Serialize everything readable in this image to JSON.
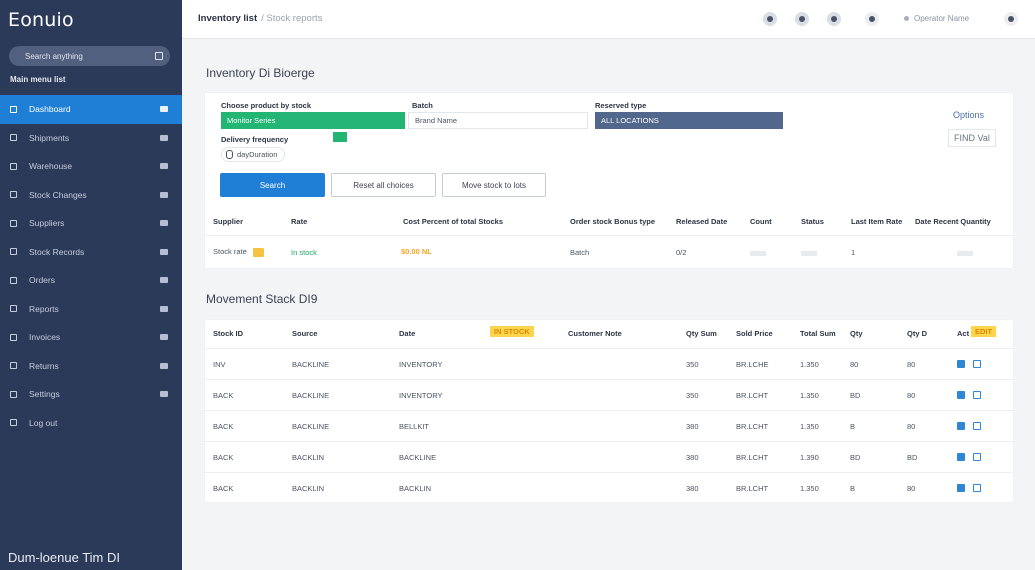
{
  "sidebar": {
    "brand": "Eonuio",
    "search_placeholder": "Search anything",
    "section_label": "Main menu list",
    "items": [
      {
        "label": "Dashboard",
        "active": true
      },
      {
        "label": "Shipments"
      },
      {
        "label": "Warehouse"
      },
      {
        "label": "Stock Changes"
      },
      {
        "label": "Suppliers"
      },
      {
        "label": "Stock Records"
      },
      {
        "label": "Orders"
      },
      {
        "label": "Reports"
      },
      {
        "label": "Invoices"
      },
      {
        "label": "Returns"
      },
      {
        "label": "Settings"
      },
      {
        "label": "Log out"
      }
    ],
    "footer": "Dum-loenue Tim DI"
  },
  "topbar": {
    "breadcrumb_main": "Inventory list",
    "breadcrumb_sub": "/ Stock reports",
    "user_label": "Operator Name"
  },
  "section1": {
    "title": "Inventory Di Bioerge",
    "fields": {
      "field1_label": "Choose product by stock",
      "field1_value": "Monitor Series",
      "field2_label": "Batch",
      "field2_value": "Brand Name",
      "field3_label": "Reserved type",
      "field3_value": "ALL LOCATIONS",
      "field4_label": "Delivery frequency",
      "radio_label": "dayDuration"
    },
    "right_link": "Options",
    "right_chip": "FIND Val",
    "buttons": {
      "primary": "Search",
      "secondary1": "Reset all choices",
      "secondary2": "Move stock to lots"
    },
    "table": {
      "headers": [
        "Supplier",
        "Rate",
        "Cost Percent of total Stocks",
        "Order stock Bonus type",
        "Released Date",
        "Count",
        "Status",
        "Last Item Rate",
        "Date Recent Quantity"
      ],
      "row": {
        "c1": "Stock rate",
        "c2": "In stock",
        "c3": "$0.00 NL",
        "c4": "Batch",
        "c5": "0/2",
        "c8": "1"
      }
    }
  },
  "section2": {
    "title": "Movement Stack DI9",
    "table": {
      "headers": [
        "Stock ID",
        "Source",
        "Date",
        "",
        "Customer Note",
        "Qty Sum",
        "Sold Price",
        "Total Sum",
        "Qty",
        "Qty D",
        "Act"
      ],
      "badge_col": "IN STOCK",
      "badge_act": "EDIT",
      "rows": [
        [
          "INV",
          "BACKLINE",
          "INVENTORY",
          "",
          "",
          "350",
          "BR.LCHE",
          "1.350",
          "80",
          "80"
        ],
        [
          "BACK",
          "BACKLINE",
          "INVENTORY",
          "",
          "",
          "350",
          "BR.LCHT",
          "1.350",
          "BD",
          "80"
        ],
        [
          "BACK",
          "BACKLINE",
          "BELLKIT",
          "",
          "",
          "380",
          "BR.LCHT",
          "1.350",
          "B",
          "80"
        ],
        [
          "BACK",
          "BACKLIN",
          "BACKLINE",
          "",
          "",
          "380",
          "BR.LCHT",
          "1.390",
          "BD",
          "BD"
        ],
        [
          "BACK",
          "BACKLIN",
          "BACKLIN",
          "",
          "",
          "380",
          "BR.LCHT",
          "1.350",
          "B",
          "80"
        ]
      ]
    }
  },
  "colors": {
    "sidebar": "#2b3a58",
    "active": "#1f7fd7",
    "green": "#22b573",
    "navy": "#51678c",
    "highlight": "#ffd54f"
  }
}
